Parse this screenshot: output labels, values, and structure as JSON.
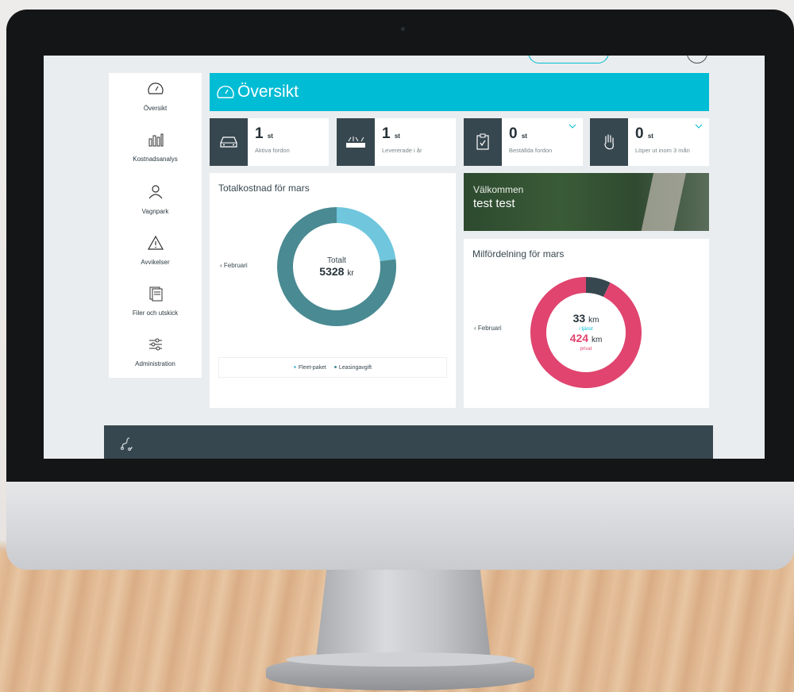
{
  "sidebar": {
    "items": [
      {
        "label": "Översikt",
        "icon": "speedometer-icon"
      },
      {
        "label": "Kostnadsanalys",
        "icon": "bar-chart-icon"
      },
      {
        "label": "Vagnpark",
        "icon": "people-icon"
      },
      {
        "label": "Avvikelser",
        "icon": "warning-icon"
      },
      {
        "label": "Filer och utskick",
        "icon": "documents-icon"
      },
      {
        "label": "Administration",
        "icon": "sliders-icon"
      }
    ]
  },
  "header": {
    "title": "Översikt",
    "color": "#00bcd4"
  },
  "stats": [
    {
      "value": "1",
      "unit": "st",
      "label": "Aktiva fordon",
      "icon": "car-icon"
    },
    {
      "value": "1",
      "unit": "st",
      "label": "Levererade i år",
      "icon": "delivery-icon"
    },
    {
      "value": "0",
      "unit": "st",
      "label": "Beställda fordon",
      "icon": "clipboard-check-icon"
    },
    {
      "value": "0",
      "unit": "st",
      "label": "Löper ut inom 3 mån",
      "icon": "hand-stop-icon"
    }
  ],
  "cost_card": {
    "title": "Totalkostnad för mars",
    "prev_label": "‹ Februari",
    "center_label": "Totalt",
    "center_value": "5328",
    "center_unit": "kr",
    "legend": [
      "Fleet-paket",
      "Leasingavgift"
    ]
  },
  "welcome": {
    "line1": "Välkommen",
    "line2": "test test"
  },
  "mileage_card": {
    "title": "Milfördelning för mars",
    "prev_label": "‹ Februari",
    "business_value": "33",
    "business_unit": "km",
    "business_label": "i tjänst",
    "private_value": "424",
    "private_unit": "km",
    "private_label": "privat"
  },
  "colors": {
    "accent": "#00bcd4",
    "dark": "#37474f",
    "teal": "#4a8a92",
    "light_blue": "#6fc6dd",
    "pink": "#e0446f"
  },
  "chart_data": [
    {
      "type": "pie",
      "title": "Totalkostnad för mars",
      "series": [
        {
          "name": "Fleet-paket",
          "value": 0.23,
          "color": "#6fc6dd"
        },
        {
          "name": "Leasingavgift",
          "value": 0.77,
          "color": "#4a8a92"
        }
      ]
    },
    {
      "type": "pie",
      "title": "Milfördelning för mars",
      "series": [
        {
          "name": "i tjänst",
          "value": 33,
          "color": "#37474f"
        },
        {
          "name": "privat",
          "value": 424,
          "color": "#e0446f"
        }
      ]
    }
  ]
}
